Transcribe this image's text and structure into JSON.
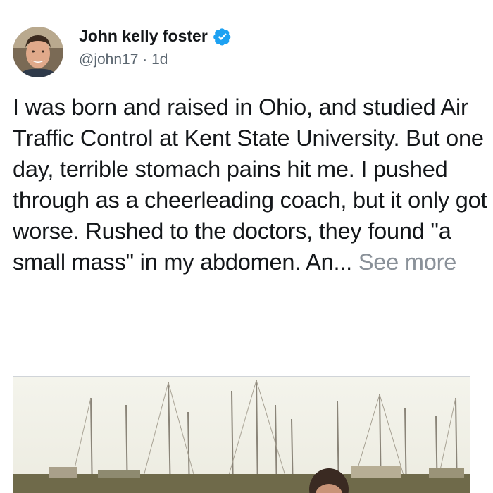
{
  "author": {
    "name": "John kelly foster",
    "handle": "@john17",
    "separator": "·",
    "time": "1d",
    "verified": true
  },
  "post": {
    "text": "I was born and raised in Ohio, and studied Air Traffic Control at Kent State University. But one day, terrible stomach pains hit me. I pushed through as a cheerleading coach, but it only got worse. Rushed to the doctors, they found \"a small mass\" in my abdomen. An...",
    "see_more": "See more"
  },
  "colors": {
    "verified_badge": "#1da1f2",
    "text": "#14171a",
    "muted": "#5b6670",
    "see_more": "#8a9199"
  },
  "icons": {
    "verified": "verified-badge-icon",
    "avatar": "profile-photo"
  }
}
